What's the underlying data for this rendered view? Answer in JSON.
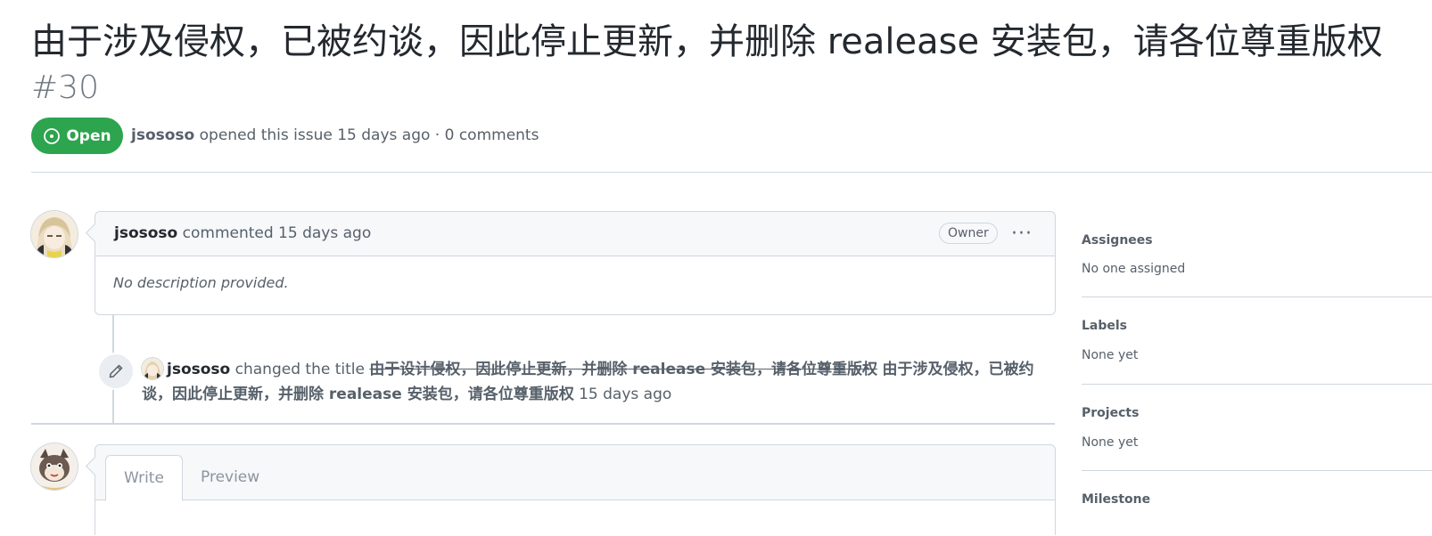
{
  "issue": {
    "title": "由于涉及侵权，已被约谈，因此停止更新，并删除 realease 安装包，请各位尊重版权",
    "number": "#30",
    "state": "Open",
    "author": "jsososo",
    "meta_text": "opened this issue 15 days ago · 0 comments"
  },
  "comment": {
    "author": "jsososo",
    "action_text": "commented 15 days ago",
    "role_label": "Owner",
    "more_label": "···",
    "body": "No description provided."
  },
  "event": {
    "author": "jsososo",
    "action_text": "changed the title",
    "old_title": "由于设计侵权，因此停止更新，并删除 realease 安装包，请各位尊重版权",
    "new_title": "由于涉及侵权，已被约谈，因此停止更新，并删除 realease 安装包，请各位尊重版权",
    "time": "15 days ago"
  },
  "new_comment": {
    "tabs": [
      "Write",
      "Preview"
    ],
    "active_tab": "Write"
  },
  "sidebar": {
    "sections": [
      {
        "heading": "Assignees",
        "value": "No one assigned"
      },
      {
        "heading": "Labels",
        "value": "None yet"
      },
      {
        "heading": "Projects",
        "value": "None yet"
      },
      {
        "heading": "Milestone",
        "value": ""
      }
    ]
  },
  "colors": {
    "open_green": "#2da44e",
    "muted_text": "#57606a",
    "border": "#d0d7de",
    "header_bg": "#f6f8fa"
  },
  "icons": {
    "state": "issue-opened-icon",
    "event": "pencil-icon",
    "more": "kebab-horizontal-icon"
  }
}
